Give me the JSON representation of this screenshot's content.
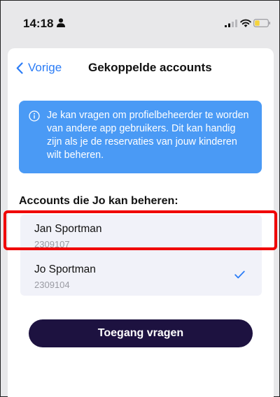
{
  "status_bar": {
    "time": "14:18",
    "icons": [
      "person-icon",
      "signal-icon",
      "wifi-icon",
      "battery-icon"
    ],
    "battery_color": "#f5d33b"
  },
  "nav": {
    "back_label": "Vorige",
    "title": "Gekoppelde accounts"
  },
  "info_banner": {
    "icon": "info-icon",
    "text": "Je kan vragen om profielbeheerder te worden van andere app gebruikers. Dit kan handig zijn als je de reservaties van jouw kinderen wilt beheren."
  },
  "accounts_section": {
    "heading": "Accounts die Jo kan beheren:",
    "items": [
      {
        "name": "Jan Sportman",
        "id": "2309107",
        "selected": false,
        "highlighted": true
      },
      {
        "name": "Jo Sportman",
        "id": "2309104",
        "selected": true,
        "highlighted": false
      }
    ]
  },
  "actions": {
    "request_access_label": "Toegang vragen"
  },
  "colors": {
    "accent": "#2b7cf6",
    "banner": "#4a9af5",
    "button": "#1d1240",
    "highlight": "#f00000"
  }
}
